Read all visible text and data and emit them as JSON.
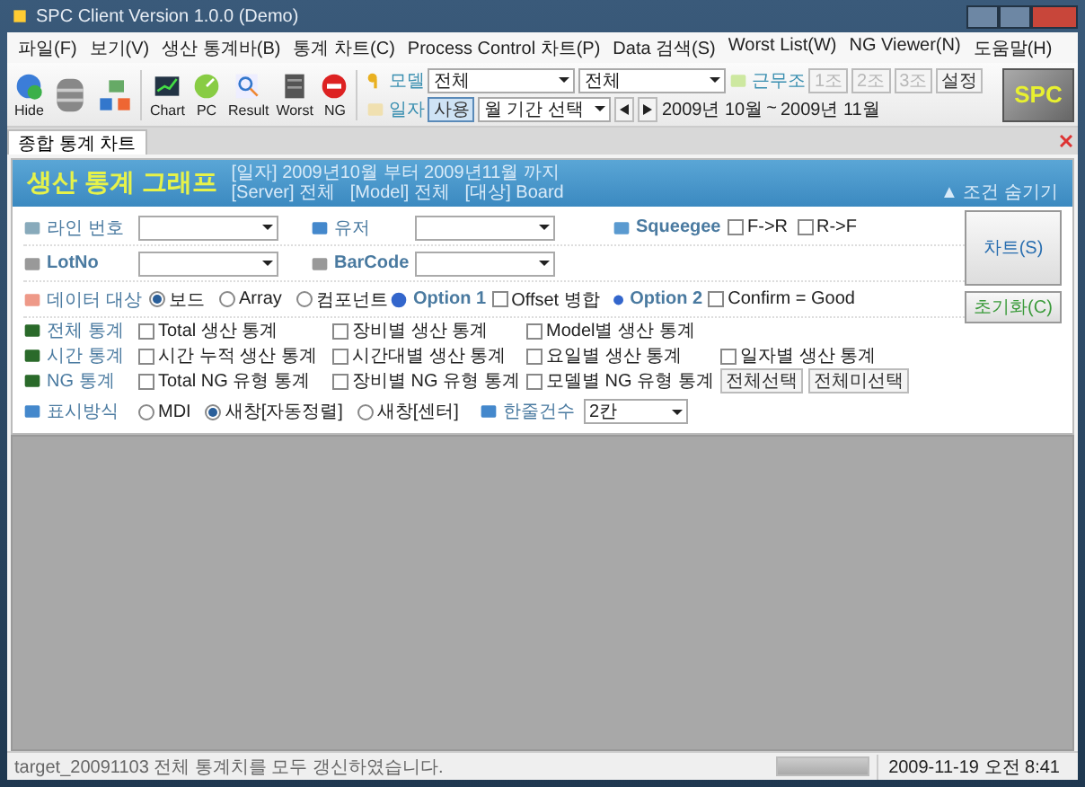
{
  "window": {
    "title": "SPC Client Version 1.0.0 (Demo)"
  },
  "menu": [
    "파일(F)",
    "보기(V)",
    "생산 통계바(B)",
    "통계 차트(C)",
    "Process Control 차트(P)",
    "Data 검색(S)",
    "Worst List(W)",
    "NG Viewer(N)",
    "도움말(H)"
  ],
  "toolbar": {
    "buttons": [
      {
        "label": "Hide"
      },
      {
        "label": "Chart"
      },
      {
        "label": "PC"
      },
      {
        "label": "Result"
      },
      {
        "label": "Worst"
      },
      {
        "label": "NG"
      }
    ],
    "model": {
      "label": "모델",
      "value_1": "전체",
      "value_2": "전체"
    },
    "shift": {
      "label": "근무조",
      "buttons": [
        {
          "label": "1조",
          "disabled": true
        },
        {
          "label": "2조",
          "disabled": true
        },
        {
          "label": "3조",
          "disabled": true
        },
        {
          "label": "설정",
          "disabled": false
        }
      ]
    },
    "date": {
      "label": "일자",
      "use_button": "사용",
      "mode": "월 기간 선택",
      "from": "2009년 10월",
      "separator": "~",
      "to": "2009년 11월"
    },
    "logo": "SPC"
  },
  "tabs": [
    {
      "label": "종합 통계 차트",
      "selected": true
    }
  ],
  "header": {
    "title": "생산 통계 그래프",
    "info_1": "[일자] 2009년10월 부터 2009년11월 까지",
    "info_2": "[Server] 전체   [Model] 전체   [대상] Board",
    "hide_link": "▲ 조건 숨기기"
  },
  "filters": {
    "line": {
      "label": "라인 번호"
    },
    "user": {
      "label": "유저"
    },
    "squeegee": {
      "label": "Squeegee",
      "options": [
        {
          "label": "F->R",
          "checked": false
        },
        {
          "label": "R->F",
          "checked": false
        }
      ]
    },
    "lot": {
      "label": "LotNo"
    },
    "barcode": {
      "label": "BarCode"
    },
    "target": {
      "label": "데이터 대상",
      "options": [
        {
          "label": "보드",
          "selected": true
        },
        {
          "label": "Array",
          "selected": false
        },
        {
          "label": "컴포넌트",
          "selected": false
        }
      ]
    },
    "option_1": {
      "label": "Option 1",
      "check": {
        "label": "Offset 병합",
        "checked": false
      }
    },
    "option_2": {
      "label": "Option 2",
      "check": {
        "label": "Confirm = Good",
        "checked": false
      }
    }
  },
  "stats": [
    {
      "label": "전체 통계",
      "items": [
        {
          "label": "Total 생산 통계",
          "checked": false
        },
        {
          "label": "장비별 생산 통계",
          "checked": false
        },
        {
          "label": "Model별 생산 통계",
          "checked": false
        }
      ]
    },
    {
      "label": "시간 통계",
      "items": [
        {
          "label": "시간 누적 생산 통계",
          "checked": false
        },
        {
          "label": "시간대별 생산 통계",
          "checked": false
        },
        {
          "label": "요일별 생산 통계",
          "checked": false
        },
        {
          "label": "일자별 생산 통계",
          "checked": false
        }
      ]
    },
    {
      "label": "NG 통계",
      "items": [
        {
          "label": "Total NG 유형 통계",
          "checked": false
        },
        {
          "label": "장비별 NG 유형 통계",
          "checked": false
        },
        {
          "label": "모델별 NG 유형 통계",
          "checked": false
        }
      ]
    }
  ],
  "select_buttons": [
    "전체선택",
    "전체미선택"
  ],
  "display": {
    "label": "표시방식",
    "options": [
      {
        "label": "MDI",
        "selected": false
      },
      {
        "label": "새창[자동정렬]",
        "selected": true
      },
      {
        "label": "새창[센터]",
        "selected": false
      }
    ],
    "per_row_label": "한줄건수",
    "per_row": "2칸"
  },
  "actions": {
    "chart": "차트(S)",
    "reset": "초기화(C)"
  },
  "status_bar": {
    "message": "target_20091103 전체 통계치를 모두 갱신하였습니다.",
    "time": "2009-11-19 오전 8:41"
  }
}
